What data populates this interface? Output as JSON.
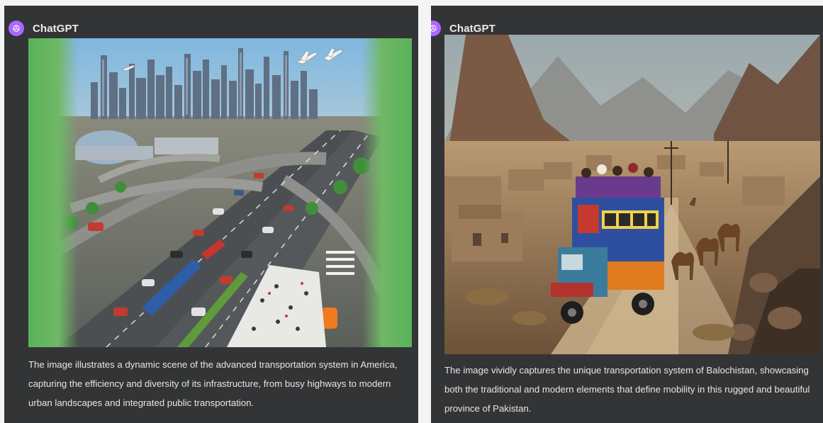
{
  "messages": [
    {
      "sender": "ChatGPT",
      "avatar_icon": "openai-logo-icon",
      "image_subject": "futuristic-city-transportation",
      "caption": "The image illustrates a dynamic scene of the advanced transportation system in America, capturing the efficiency and diversity of its infrastructure, from busy highways to modern urban landscapes and integrated public transportation."
    },
    {
      "sender": "ChatGPT",
      "avatar_icon": "openai-logo-icon",
      "image_subject": "desert-truck-camels",
      "caption": "The image vividly captures the unique transportation system of Balochistan, showcasing both the traditional and modern elements that define mobility in this rugged and beautiful province of Pakistan."
    }
  ],
  "colors": {
    "panel_bg": "#333436",
    "avatar_bg": "#ab68ff",
    "text": "#e6e6e6",
    "frame_green": "#58b25a"
  }
}
